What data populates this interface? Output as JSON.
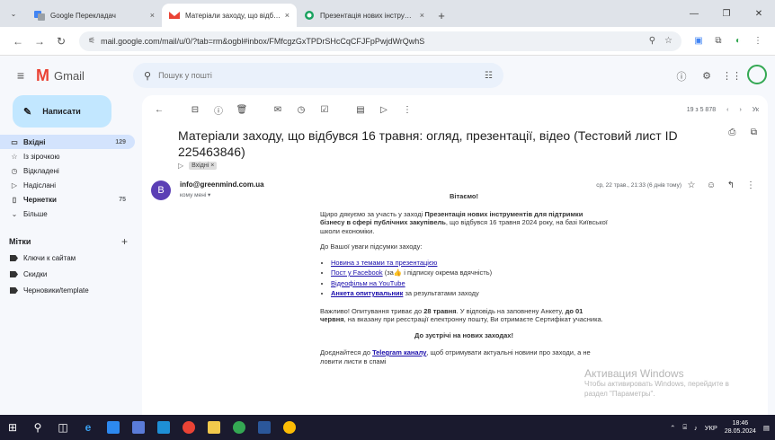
{
  "browser": {
    "tabs": [
      {
        "label": "Google Перекладач",
        "close": "×"
      },
      {
        "label": "Матеріали заходу, що відбувся",
        "close": "×"
      },
      {
        "label": "Презентація нових інструмент",
        "close": "×"
      }
    ],
    "new_tab": "+",
    "url": "mail.google.com/mail/u/0/?tab=rm&ogbl#inbox/FMfcgzGxTPDrSHcCqCFJFpPwjdWrQwhS"
  },
  "gmail": {
    "logo_text": "Gmail",
    "search_placeholder": "Пошук у пошті"
  },
  "sidebar": {
    "compose": "Написати",
    "items": [
      {
        "icon": "inbox-icon",
        "label": "Вхідні",
        "count": "129"
      },
      {
        "icon": "star-icon",
        "label": "Із зірочкою",
        "count": ""
      },
      {
        "icon": "clock-icon",
        "label": "Відкладені",
        "count": ""
      },
      {
        "icon": "send-icon",
        "label": "Надіслані",
        "count": ""
      },
      {
        "icon": "draft-icon",
        "label": "Чернетки",
        "count": "75"
      },
      {
        "icon": "chevron-down-icon",
        "label": "Більше",
        "count": ""
      }
    ],
    "labels_title": "Мітки",
    "labels": [
      "Ключи к сайтам",
      "Скидки",
      "Черновики/template"
    ]
  },
  "message": {
    "pager": "19 з 5 878",
    "lang": "Ук",
    "subject": "Матеріали заходу, що відбувся 16 травня: огляд, презентації, відео (Тестовий лист ID 225463846)",
    "chip": "Вхідні ×",
    "sender": "info@greenmind.com.ua",
    "to": "кому мені ▾",
    "date": "ср, 22 трав., 21:33 (6 днів тому)",
    "avatar_letter": "B"
  },
  "body": {
    "greeting": "Вітаємо!",
    "p1_a": "Щиро дякуємо за участь у заході ",
    "p1_b": "Презентація нових інструментів для підтримки бізнесу в сфері публічних закупівель",
    "p1_c": ", що відбувся 16 травня 2024 року, на базі Київської школи економіки.",
    "p2": "До Вашої уваги підсумки заходу:",
    "li1": "Новина з темами та презентацією",
    "li2_link": "Пост у Facebook",
    "li2_rest": " (за👍 і підписку окрема вдячність)",
    "li3": "Відеофільм на YouTube",
    "li4_link": "Анкета опитувальник",
    "li4_rest": " за результатами заходу",
    "p3_a": "Важливо! Опитування триває до ",
    "p3_b": "28 травня",
    "p3_c": ". У відповідь на заповнену Анкету, ",
    "p3_d": "до 01 червня",
    "p3_e": ", на вказану при реєстрації електронну пошту, Ви отримаєте Сертифікат учасника.",
    "p4": "До зустрічі на нових заходах!",
    "p5_a": "Доєднайтеся до ",
    "p5_b": "Telegram каналу",
    "p5_c": ", щоб отримувати актуальні новини про заходи, а не ловити листи в спамі"
  },
  "watermark": {
    "line1": "Активация Windows",
    "line2": "Чтобы активировать Windows, перейдите в",
    "line3": "раздел \"Параметры\"."
  },
  "taskbar": {
    "lang": "УКР",
    "time": "18:46",
    "date": "28.05.2024"
  }
}
